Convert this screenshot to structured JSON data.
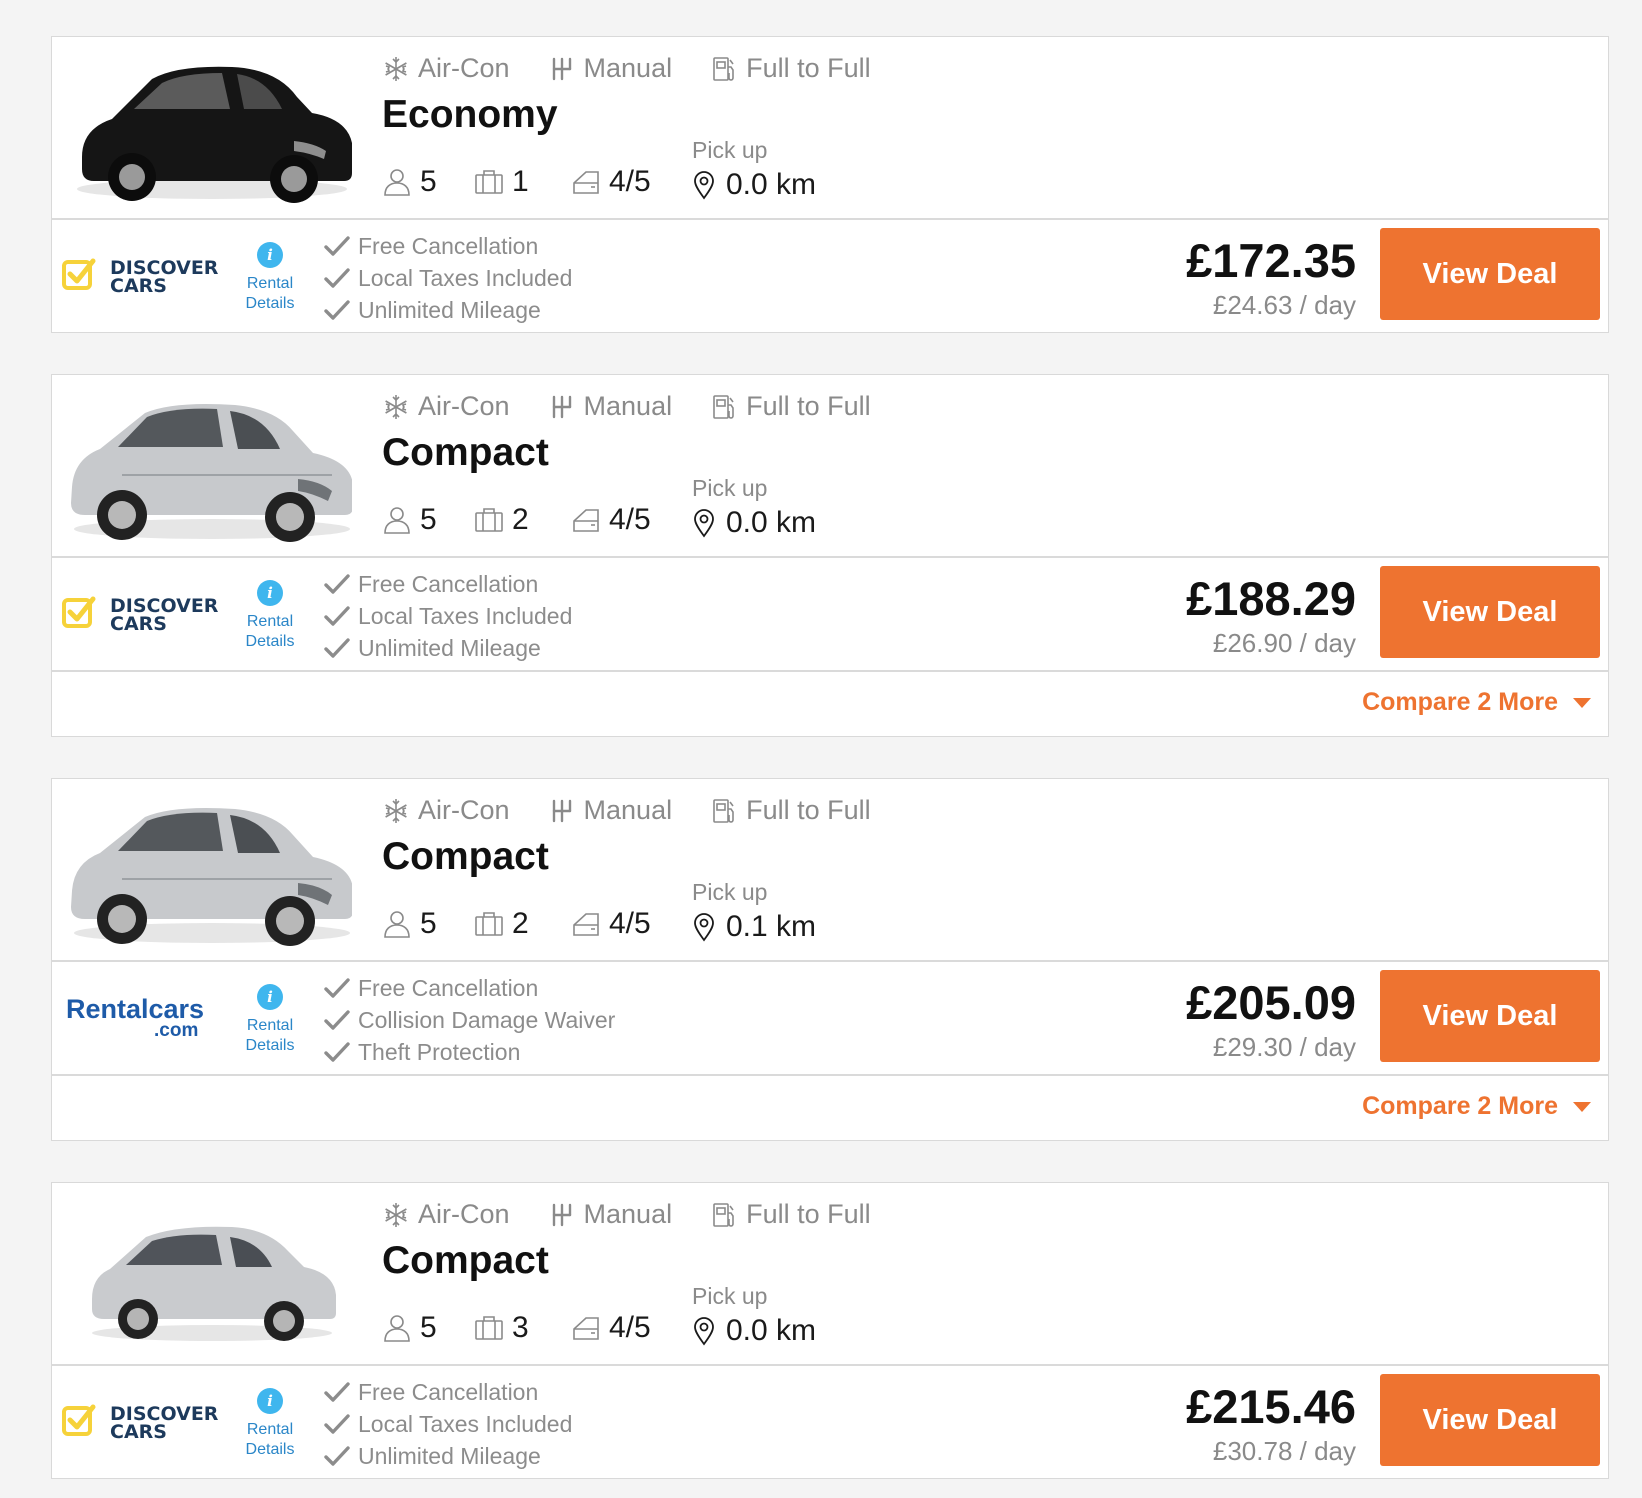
{
  "colors": {
    "accent": "#ee7330",
    "info": "#3fb6ee",
    "link": "#2a86c8",
    "muted": "#8a8a8a"
  },
  "cards": [
    {
      "image": "black-hatchback-image",
      "features": {
        "aircon": "Air-Con",
        "transmission": "Manual",
        "fuel": "Full to Full"
      },
      "category": "Economy",
      "seats": "5",
      "bags": "1",
      "doors": "4/5",
      "pickup_label": "Pick up",
      "pickup_distance": "0.0 km",
      "supplier": "DISCOVER CARS",
      "rental_details": [
        "Rental",
        "Details"
      ],
      "perks": [
        "Free Cancellation",
        "Local Taxes Included",
        "Unlimited Mileage"
      ],
      "price_total": "£172.35",
      "price_day": "£24.63 / day",
      "cta": "View Deal"
    },
    {
      "image": "silver-hatchback-image",
      "features": {
        "aircon": "Air-Con",
        "transmission": "Manual",
        "fuel": "Full to Full"
      },
      "category": "Compact",
      "seats": "5",
      "bags": "2",
      "doors": "4/5",
      "pickup_label": "Pick up",
      "pickup_distance": "0.0 km",
      "supplier": "DISCOVER CARS",
      "rental_details": [
        "Rental",
        "Details"
      ],
      "perks": [
        "Free Cancellation",
        "Local Taxes Included",
        "Unlimited Mileage"
      ],
      "price_total": "£188.29",
      "price_day": "£26.90 / day",
      "cta": "View Deal",
      "compare": "Compare 2 More"
    },
    {
      "image": "silver-hatchback-image",
      "features": {
        "aircon": "Air-Con",
        "transmission": "Manual",
        "fuel": "Full to Full"
      },
      "category": "Compact",
      "seats": "5",
      "bags": "2",
      "doors": "4/5",
      "pickup_label": "Pick up",
      "pickup_distance": "0.1 km",
      "supplier": "Rentalcars.com",
      "rental_details": [
        "Rental",
        "Details"
      ],
      "perks": [
        "Free Cancellation",
        "Collision Damage Waiver",
        "Theft Protection"
      ],
      "price_total": "£205.09",
      "price_day": "£29.30 / day",
      "cta": "View Deal",
      "compare": "Compare 2 More"
    },
    {
      "image": "silver-estate-image",
      "features": {
        "aircon": "Air-Con",
        "transmission": "Manual",
        "fuel": "Full to Full"
      },
      "category": "Compact",
      "seats": "5",
      "bags": "3",
      "doors": "4/5",
      "pickup_label": "Pick up",
      "pickup_distance": "0.0 km",
      "supplier": "DISCOVER CARS",
      "rental_details": [
        "Rental",
        "Details"
      ],
      "perks": [
        "Free Cancellation",
        "Local Taxes Included",
        "Unlimited Mileage"
      ],
      "price_total": "£215.46",
      "price_day": "£30.78 / day",
      "cta": "View Deal"
    }
  ]
}
